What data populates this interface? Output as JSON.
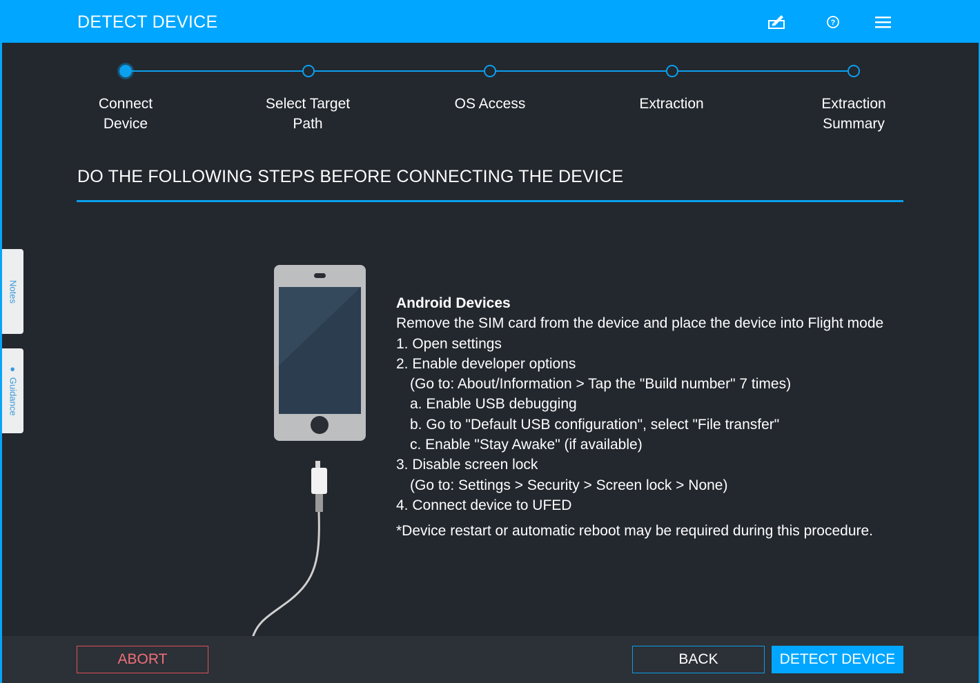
{
  "header": {
    "title": "DETECT DEVICE",
    "icons": [
      "report-icon",
      "help-icon",
      "menu-icon"
    ]
  },
  "steps": [
    {
      "label_line1": "Connect",
      "label_line2": "Device",
      "state": "active"
    },
    {
      "label_line1": "Select Target",
      "label_line2": "Path",
      "state": "pending"
    },
    {
      "label_line1": "OS Access",
      "label_line2": "",
      "state": "pending"
    },
    {
      "label_line1": "Extraction",
      "label_line2": "",
      "state": "pending"
    },
    {
      "label_line1": "Extraction",
      "label_line2": "Summary",
      "state": "pending"
    }
  ],
  "section": {
    "title": "DO THE FOLLOWING STEPS BEFORE CONNECTING THE DEVICE"
  },
  "side_tabs": {
    "notes": "Notes",
    "guidance": "Guidance"
  },
  "instructions": {
    "heading": "Android Devices",
    "intro": "Remove the SIM card from the device and place the device into Flight mode",
    "step1": "1. Open settings",
    "step2": "2. Enable developer options",
    "step2_detail": "(Go to: About/Information > Tap the \"Build number\" 7 times)",
    "step2a": "a. Enable USB debugging",
    "step2b": "b. Go to \"Default USB configuration\", select \"File transfer\"",
    "step2c": "c. Enable \"Stay Awake\" (if available)",
    "step3": "3. Disable screen lock",
    "step3_detail": "(Go to: Settings > Security > Screen lock > None)",
    "step4": "4. Connect device to UFED",
    "note": "*Device restart or automatic reboot may be required during this procedure."
  },
  "footer": {
    "abort_label": "ABORT",
    "back_label": "BACK",
    "detect_label": "DETECT DEVICE"
  },
  "colors": {
    "accent": "#00a6ff",
    "background": "#23272e",
    "abort": "#e0525a"
  }
}
